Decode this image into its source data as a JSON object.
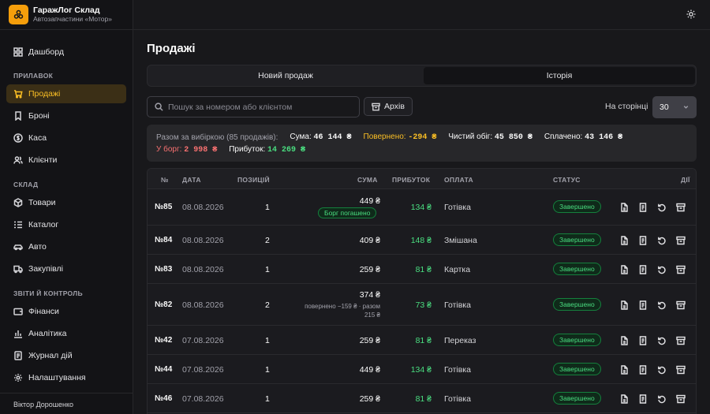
{
  "app": {
    "title": "ГаражЛог Склад",
    "subtitle": "Автозапчастини «Мотор»"
  },
  "sidebar": {
    "dashboard": "Дашборд",
    "sections": {
      "counter": "ПРИЛАВОК",
      "warehouse": "СКЛАД",
      "reports": "ЗВІТИ Й КОНТРОЛЬ"
    },
    "items": {
      "sales": "Продажі",
      "reservations": "Броні",
      "cash": "Каса",
      "clients": "Клієнти",
      "goods": "Товари",
      "catalog": "Каталог",
      "auto": "Авто",
      "purchases": "Закупівлі",
      "finance": "Фінанси",
      "analytics": "Аналітика",
      "journal": "Журнал дій",
      "settings": "Налаштування"
    },
    "user": "Віктор Дорошенко"
  },
  "page": {
    "title": "Продажі"
  },
  "tabs": {
    "new_sale": "Новий продаж",
    "history": "Історія"
  },
  "toolbar": {
    "search_placeholder": "Пошук за номером або клієнтом",
    "archive": "Архів",
    "per_page_label": "На сторінці",
    "per_page_value": "30"
  },
  "summary": {
    "label": "Разом за вибіркою (85 продажів):",
    "sum_label": "Сума:",
    "sum_value": "46 144 ₴",
    "returned_label": "Повернено:",
    "returned_value": "-294 ₴",
    "net_label": "Чистий обіг:",
    "net_value": "45 850 ₴",
    "paid_label": "Сплачено:",
    "paid_value": "43 146 ₴",
    "debt_label": "У борг:",
    "debt_value": "2 998 ₴",
    "profit_label": "Прибуток:",
    "profit_value": "14 269 ₴"
  },
  "table": {
    "headers": {
      "num": "№",
      "date": "ДАТА",
      "positions": "ПОЗИЦІЙ",
      "sum": "СУМА",
      "profit": "ПРИБУТОК",
      "payment": "ОПЛАТА",
      "status": "СТАТУС",
      "actions": "ДІЇ"
    },
    "rows": [
      {
        "num": "№85",
        "date": "08.08.2026",
        "positions": "1",
        "sum": "449 ₴",
        "badge": "Борг погашено",
        "profit": "134 ₴",
        "payment": "Готівка",
        "status": "Завершено"
      },
      {
        "num": "№84",
        "date": "08.08.2026",
        "positions": "2",
        "sum": "409 ₴",
        "profit": "148 ₴",
        "payment": "Змішана",
        "status": "Завершено"
      },
      {
        "num": "№83",
        "date": "08.08.2026",
        "positions": "1",
        "sum": "259 ₴",
        "profit": "81 ₴",
        "payment": "Картка",
        "status": "Завершено"
      },
      {
        "num": "№82",
        "date": "08.08.2026",
        "positions": "2",
        "sum": "374 ₴",
        "note1": "повернено −159 ₴ · разом",
        "note2": "215 ₴",
        "profit": "73 ₴",
        "payment": "Готівка",
        "status": "Завершено"
      },
      {
        "num": "№42",
        "date": "07.08.2026",
        "positions": "1",
        "sum": "259 ₴",
        "profit": "81 ₴",
        "payment": "Переказ",
        "status": "Завершено"
      },
      {
        "num": "№44",
        "date": "07.08.2026",
        "positions": "1",
        "sum": "449 ₴",
        "profit": "134 ₴",
        "payment": "Готівка",
        "status": "Завершено"
      },
      {
        "num": "№46",
        "date": "07.08.2026",
        "positions": "1",
        "sum": "259 ₴",
        "profit": "81 ₴",
        "payment": "Готівка",
        "status": "Завершено"
      }
    ]
  },
  "icons": {
    "logo": "hexagon-logo-icon",
    "theme": "sun-icon",
    "search": "search-icon",
    "archive": "archive-box-icon",
    "row_actions": [
      "document-icon",
      "receipt-icon",
      "return-icon",
      "archive-icon"
    ]
  },
  "colors": {
    "accent": "#f59e0b",
    "success": "#4ade80",
    "danger": "#f87171"
  }
}
